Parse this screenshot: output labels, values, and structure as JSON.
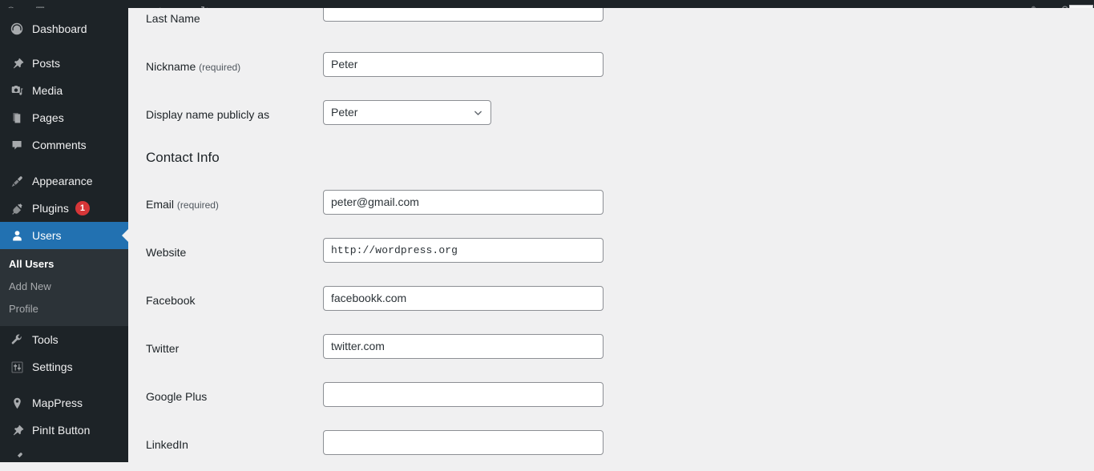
{
  "theme": {
    "sidebar_bg": "#1d2327",
    "submenu_bg": "#2c3338",
    "accent_blue": "#2271b1",
    "badge_red": "#d63638",
    "content_bg": "#f0f0f1",
    "field_border": "#8c8f94",
    "text_dark": "#1d2327",
    "text_muted": "#a7aaad"
  },
  "adminbar": {
    "glyphs": [
      "ⓘ",
      "⎘",
      "↻",
      "✎",
      "+",
      "↯",
      "✉"
    ]
  },
  "sidebar": {
    "items": [
      {
        "label": "Dashboard",
        "icon": "dashboard-icon",
        "active": false,
        "badge": ""
      },
      {
        "label": "Posts",
        "icon": "pin-icon",
        "active": false,
        "badge": ""
      },
      {
        "label": "Media",
        "icon": "media-icon",
        "active": false,
        "badge": ""
      },
      {
        "label": "Pages",
        "icon": "pages-icon",
        "active": false,
        "badge": ""
      },
      {
        "label": "Comments",
        "icon": "comment-icon",
        "active": false,
        "badge": ""
      },
      {
        "label": "Appearance",
        "icon": "paintbrush-icon",
        "active": false,
        "badge": ""
      },
      {
        "label": "Plugins",
        "icon": "plug-icon",
        "active": false,
        "badge": "1"
      },
      {
        "label": "Users",
        "icon": "user-icon",
        "active": true,
        "badge": ""
      },
      {
        "label": "Tools",
        "icon": "wrench-icon",
        "active": false,
        "badge": ""
      },
      {
        "label": "Settings",
        "icon": "sliders-icon",
        "active": false,
        "badge": ""
      },
      {
        "label": "MapPress",
        "icon": "map-pin-icon",
        "active": false,
        "badge": ""
      },
      {
        "label": "PinIt Button",
        "icon": "pin-icon",
        "active": false,
        "badge": ""
      }
    ],
    "users_submenu": [
      {
        "label": "All Users",
        "current": true
      },
      {
        "label": "Add New",
        "current": false
      },
      {
        "label": "Profile",
        "current": false
      }
    ]
  },
  "main": {
    "section_heading": "Contact Info",
    "fields": [
      {
        "label": "Last Name",
        "required": "",
        "value": "",
        "type": "text",
        "clipped": true
      },
      {
        "label": "Nickname",
        "required": "(required)",
        "value": "Peter",
        "type": "text",
        "clipped": false
      },
      {
        "label": "Display name publicly as",
        "required": "",
        "value": "Peter",
        "type": "select",
        "clipped": false
      },
      {
        "label": "Email",
        "required": "(required)",
        "value": "peter@gmail.com",
        "type": "text",
        "clipped": false
      },
      {
        "label": "Website",
        "required": "",
        "value": "http://wordpress.org",
        "type": "mono",
        "clipped": false
      },
      {
        "label": "Facebook",
        "required": "",
        "value": "facebookk.com",
        "type": "text",
        "clipped": false
      },
      {
        "label": "Twitter",
        "required": "",
        "value": "twitter.com",
        "type": "text",
        "clipped": false
      },
      {
        "label": "Google Plus",
        "required": "",
        "value": "",
        "type": "text",
        "clipped": false
      },
      {
        "label": "LinkedIn",
        "required": "",
        "value": "",
        "type": "text",
        "clipped": false
      }
    ],
    "select_options": [
      "Peter"
    ]
  }
}
